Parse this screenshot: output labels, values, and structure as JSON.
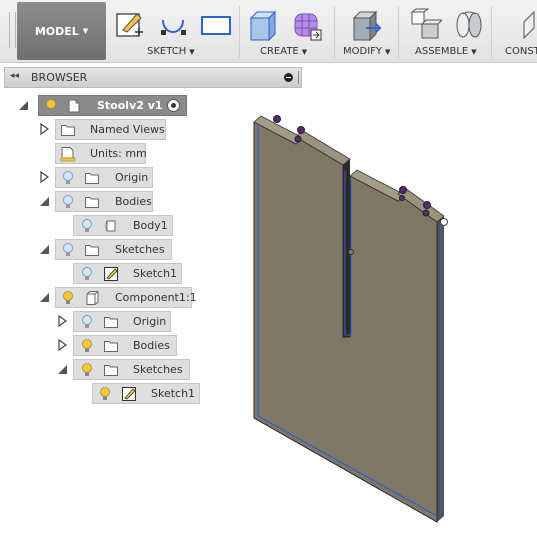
{
  "toolbar": {
    "workspace": "MODEL",
    "groups": {
      "sketch": "SKETCH",
      "create": "CREATE",
      "modify": "MODIFY",
      "assemble": "ASSEMBLE",
      "construct": "CONST"
    }
  },
  "browser": {
    "title": "BROWSER",
    "tree": {
      "root": "Stoolv2 v1",
      "named_views": "Named Views",
      "units": "Units: mm",
      "origin": "Origin",
      "bodies": "Bodies",
      "body1": "Body1",
      "sketches": "Sketches",
      "sketch1": "Sketch1",
      "component": "Component1:1",
      "comp_origin": "Origin",
      "comp_bodies": "Bodies",
      "comp_sketches": "Sketches",
      "comp_sketch1": "Sketch1"
    }
  },
  "colors": {
    "selected_root": "#8a8a8a",
    "node_bg": "#dedede",
    "bulb_on": "#f2c53d",
    "bulb_off": "#9cc3e6",
    "body_face": "#807866",
    "body_edge": "#2f5fd0"
  }
}
